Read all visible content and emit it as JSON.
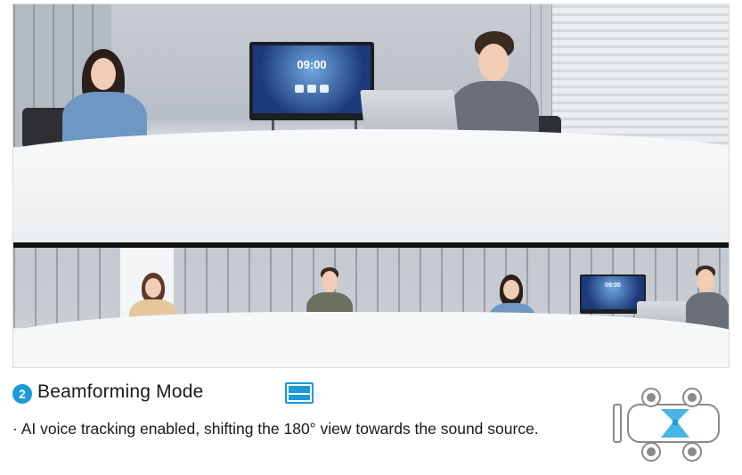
{
  "top_view": {
    "tv_clock": "09:00"
  },
  "bottom_view": {
    "tv_clock": "09:00"
  },
  "caption": {
    "step_number": "2",
    "title": "Beamforming Mode",
    "description": "· AI voice tracking enabled, shifting the 180° view towards the sound source."
  },
  "colors": {
    "accent": "#1b9ad6",
    "diagram_gray": "#8a8a8a"
  },
  "icons": {
    "mode": "panoramic-split-screen-icon",
    "diagram": "meeting-room-beamforming-diagram-icon"
  }
}
